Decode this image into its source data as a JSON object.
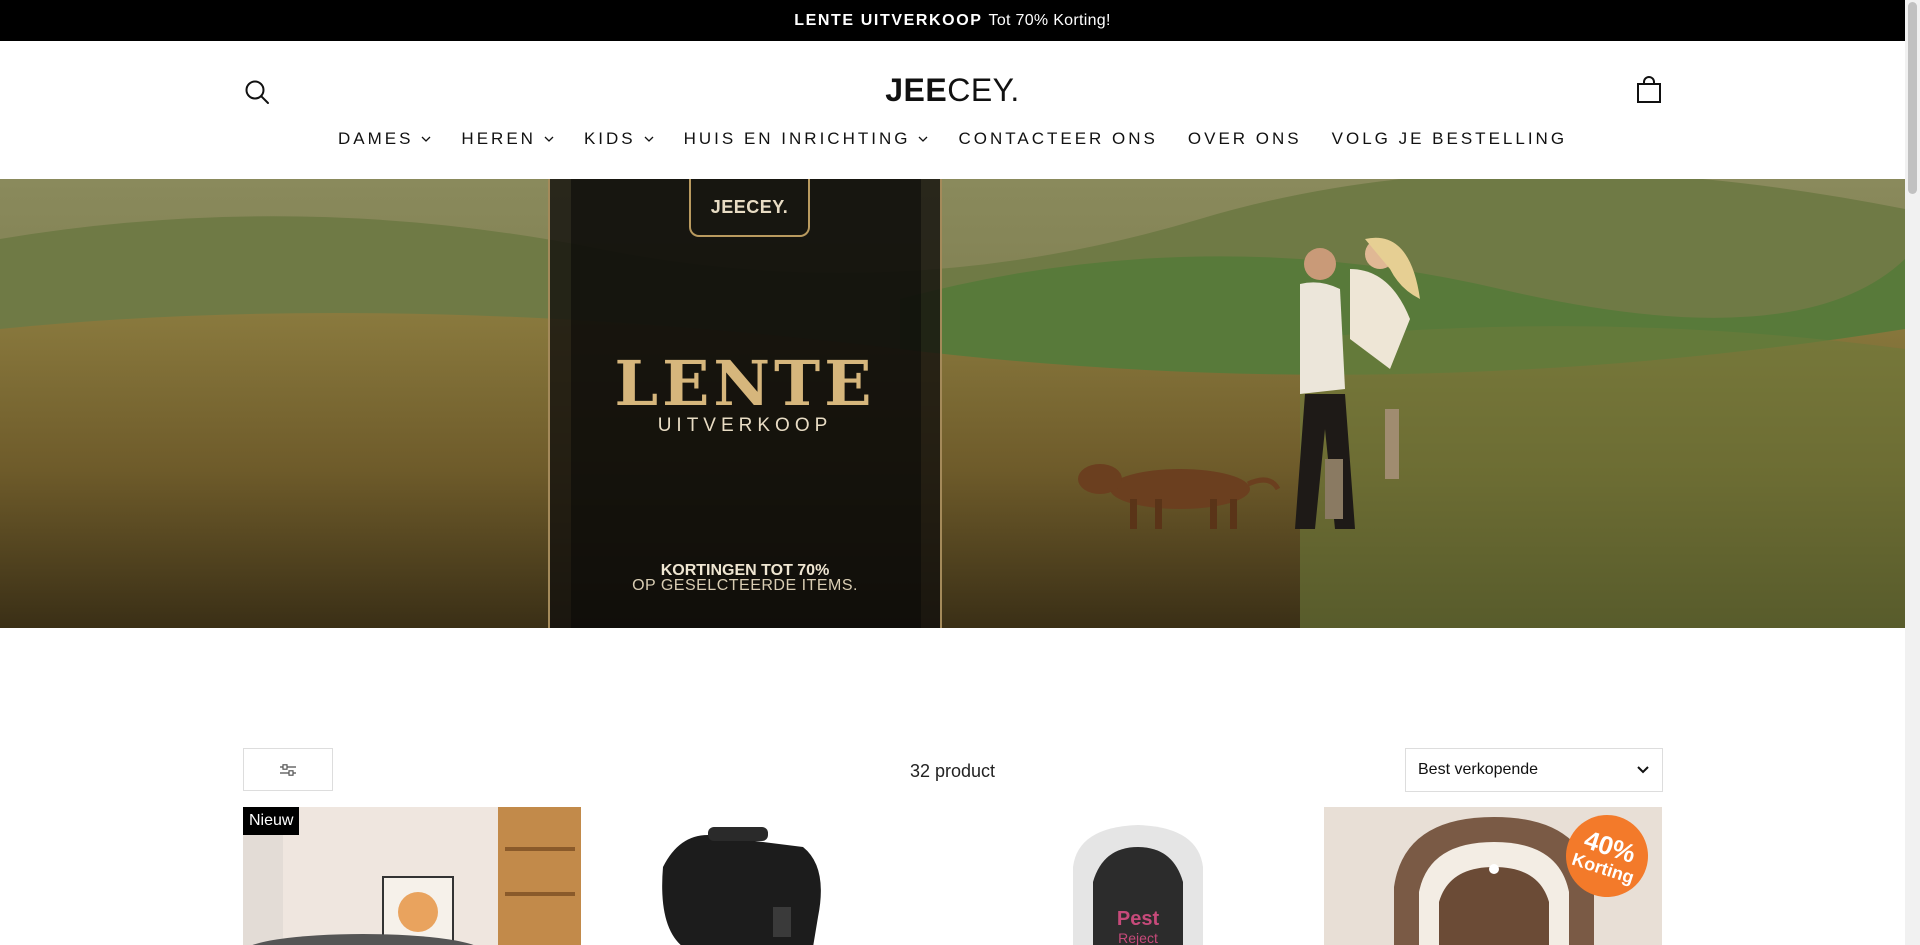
{
  "announcement": {
    "bold": "LENTE UITVERKOOP",
    "rest": "Tot 70% Korting!"
  },
  "header": {
    "logo_bold": "JEE",
    "logo_light": "CEY.",
    "search_icon": "search-icon",
    "cart_icon": "shopping-bag-icon"
  },
  "nav": [
    {
      "label": "DAMES",
      "dropdown": true
    },
    {
      "label": "HEREN",
      "dropdown": true
    },
    {
      "label": "KIDS",
      "dropdown": true
    },
    {
      "label": "HUIS EN INRICHTING",
      "dropdown": true
    },
    {
      "label": "CONTACTEER ONS",
      "dropdown": false
    },
    {
      "label": "OVER ONS",
      "dropdown": false
    },
    {
      "label": "VOLG JE BESTELLING",
      "dropdown": false
    }
  ],
  "hero": {
    "badge": "JEECEY.",
    "title": "LENTE",
    "subtitle": "UITVERKOOP",
    "line1": "KORTINGEN TOT 70%",
    "line2": "OP GESELCTEERDE ITEMS."
  },
  "collection": {
    "filter_icon": "sliders-icon",
    "count": "32 product",
    "sort_selected": "Best verkopende"
  },
  "products": [
    {
      "badge": "Nieuw",
      "kind": "pet bed"
    },
    {
      "kind": "dog harness"
    },
    {
      "kind": "pest repeller",
      "logo_text": "Pest Reject"
    },
    {
      "discount_pct": "40%",
      "discount_word": "Korting",
      "kind": "pet house"
    }
  ],
  "colors": {
    "announce_bg": "#000000",
    "accent_gold": "#d6b67c",
    "discount_orange": "#f37a2a"
  }
}
